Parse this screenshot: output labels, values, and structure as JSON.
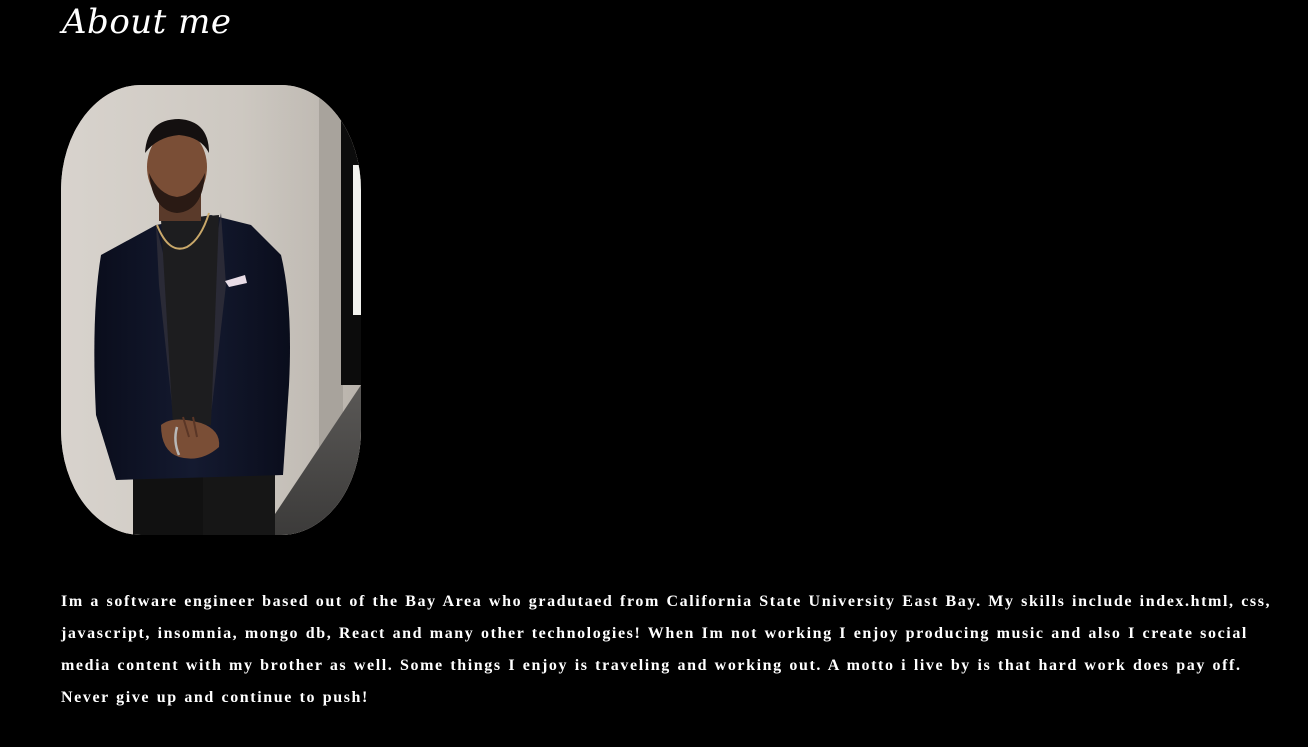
{
  "about": {
    "title": "About me",
    "bio": "Im a software engineer based out of the Bay Area who gradutaed from California State University East Bay. My skills include index.html, css, javascript, insomnia, mongo db, React and many other technologies! When Im not working I enjoy producing music and also I create social media content with my brother as well. Some things I enjoy is traveling and working out. A motto i live by is that hard work does pay off. Never give up and continue to push!"
  },
  "colors": {
    "background": "#000000",
    "text": "#ffffff"
  }
}
